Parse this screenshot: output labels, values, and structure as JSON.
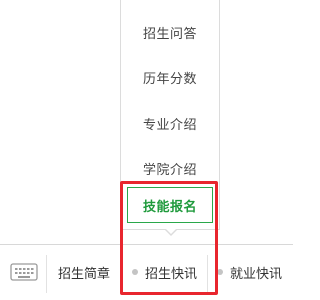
{
  "popup_menu": {
    "items": [
      {
        "label": "招生问答"
      },
      {
        "label": "历年分数"
      },
      {
        "label": "专业介绍"
      },
      {
        "label": "学院介绍"
      },
      {
        "label": "技能报名"
      }
    ],
    "active_index": 4
  },
  "bottom_bar": {
    "keyboard_icon": "keyboard-icon",
    "items": [
      {
        "label": "招生简章"
      },
      {
        "label": "招生快讯"
      },
      {
        "label": "就业快讯"
      }
    ]
  },
  "colors": {
    "active_green": "#1f9a3c",
    "highlight_red": "#e8262e"
  }
}
